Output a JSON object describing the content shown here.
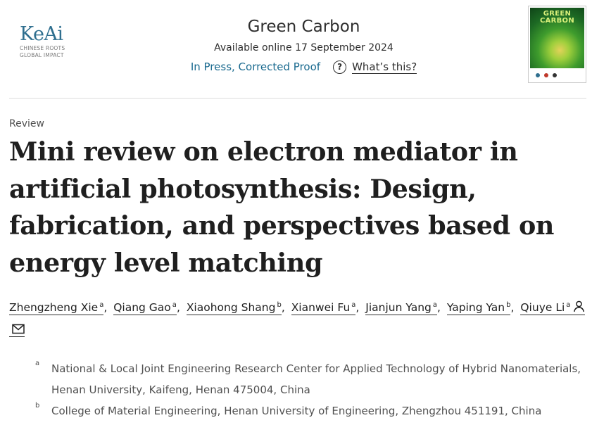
{
  "publisher": {
    "wordmark": "KeAi",
    "tagline_line1": "CHINESE ROOTS",
    "tagline_line2": "GLOBAL IMPACT",
    "color": "#2f6f8f"
  },
  "journal": {
    "title": "Green Carbon",
    "availability": "Available online 17 September 2024",
    "status_link": "In Press, Corrected Proof",
    "help_icon": "question-circle-icon",
    "help_link": "What’s this?",
    "link_color": "#1a6a8f"
  },
  "cover": {
    "title_line1": "GREEN",
    "title_line2": "CARBON"
  },
  "article": {
    "type": "Review",
    "title": "Mini review on electron mediator in artificial photosynthesis: Design, fabrication, and perspectives based on energy level matching"
  },
  "authors": [
    {
      "name": "Zhengzheng Xie",
      "affil": "a"
    },
    {
      "name": "Qiang Gao",
      "affil": "a"
    },
    {
      "name": "Xiaohong Shang",
      "affil": "b"
    },
    {
      "name": "Xianwei Fu",
      "affil": "a"
    },
    {
      "name": "Jianjun Yang",
      "affil": "a"
    },
    {
      "name": "Yaping Yan",
      "affil": "b"
    },
    {
      "name": "Qiuye Li",
      "affil": "a",
      "icons": [
        "person-icon",
        "envelope-icon"
      ]
    }
  ],
  "affiliations": [
    {
      "mark": "a",
      "text": "National & Local Joint Engineering Research Center for Applied Technology of Hybrid Nanomaterials, Henan University, Kaifeng, Henan 475004, China"
    },
    {
      "mark": "b",
      "text": "College of Material Engineering, Henan University of Engineering, Zhengzhou 451191, China"
    }
  ]
}
